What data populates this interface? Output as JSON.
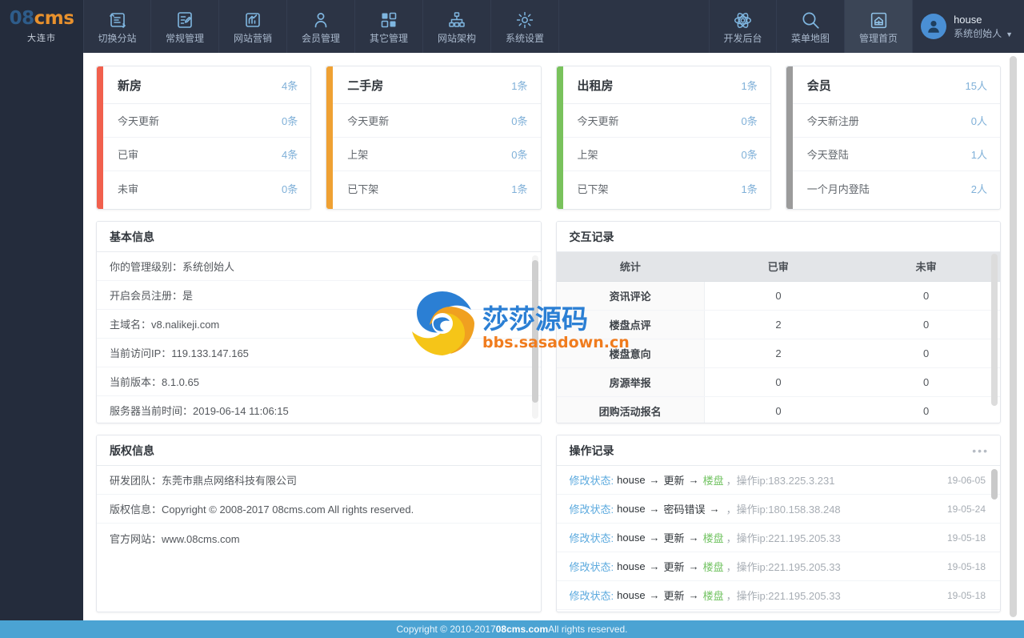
{
  "header": {
    "logo": {
      "part1": "08",
      "part2": "cms",
      "city": "大连市"
    },
    "nav_left": [
      {
        "label": "切换分站",
        "icon": "switch-site-icon"
      },
      {
        "label": "常规管理",
        "icon": "general-manage-icon"
      },
      {
        "label": "网站营销",
        "icon": "marketing-icon"
      },
      {
        "label": "会员管理",
        "icon": "member-icon"
      },
      {
        "label": "其它管理",
        "icon": "other-manage-icon"
      },
      {
        "label": "网站架构",
        "icon": "site-structure-icon"
      },
      {
        "label": "系统设置",
        "icon": "settings-icon"
      }
    ],
    "nav_right": [
      {
        "label": "开发后台",
        "icon": "dev-backend-icon",
        "active": false
      },
      {
        "label": "菜单地图",
        "icon": "search-icon",
        "active": false
      },
      {
        "label": "管理首页",
        "icon": "home-icon",
        "active": true
      }
    ],
    "user": {
      "name": "house",
      "role": "系统创始人",
      "caret": "▼"
    }
  },
  "stats": [
    {
      "title": "新房",
      "total": "4条",
      "color": "#f1604d",
      "rows": [
        {
          "label": "今天更新",
          "value": "0条"
        },
        {
          "label": "已审",
          "value": "4条"
        },
        {
          "label": "未审",
          "value": "0条"
        }
      ]
    },
    {
      "title": "二手房",
      "total": "1条",
      "color": "#efa133",
      "rows": [
        {
          "label": "今天更新",
          "value": "0条"
        },
        {
          "label": "上架",
          "value": "0条"
        },
        {
          "label": "已下架",
          "value": "1条"
        }
      ]
    },
    {
      "title": "出租房",
      "total": "1条",
      "color": "#79c25c",
      "rows": [
        {
          "label": "今天更新",
          "value": "0条"
        },
        {
          "label": "上架",
          "value": "0条"
        },
        {
          "label": "已下架",
          "value": "1条"
        }
      ]
    },
    {
      "title": "会员",
      "total": "15人",
      "color": "#9b9b9b",
      "rows": [
        {
          "label": "今天新注册",
          "value": "0人"
        },
        {
          "label": "今天登陆",
          "value": "1人"
        },
        {
          "label": "一个月内登陆",
          "value": "2人"
        }
      ]
    }
  ],
  "basic_info": {
    "title": "基本信息",
    "rows": [
      "你的管理级别：系统创始人",
      "开启会员注册：是",
      "主域名：v8.nalikeji.com",
      "当前访问IP：119.133.147.165",
      "当前版本：8.1.0.65",
      "服务器当前时间：2019-06-14 11:06:15"
    ]
  },
  "interaction": {
    "title": "交互记录",
    "columns": [
      "统计",
      "已审",
      "未审"
    ],
    "rows": [
      {
        "name": "资讯评论",
        "approved": "0",
        "pending": "0"
      },
      {
        "name": "楼盘点评",
        "approved": "2",
        "pending": "0"
      },
      {
        "name": "楼盘意向",
        "approved": "2",
        "pending": "0"
      },
      {
        "name": "房源举报",
        "approved": "0",
        "pending": "0"
      },
      {
        "name": "团购活动报名",
        "approved": "0",
        "pending": "0"
      }
    ]
  },
  "copyright_panel": {
    "title": "版权信息",
    "rows": [
      "研发团队：东莞市鼎点网络科技有限公司",
      "版权信息：Copyright © 2008-2017 08cms.com All rights reserved.",
      "官方网站：www.08cms.com"
    ]
  },
  "oplog": {
    "title": "操作记录",
    "more": "•••",
    "rows": [
      {
        "action": "修改状态:",
        "user": "house",
        "op": "更新",
        "object": "楼盘",
        "ip": "，操作ip:183.225.3.231",
        "date": "19-06-05"
      },
      {
        "action": "修改状态:",
        "user": "house",
        "op": "密码错误",
        "object": "",
        "ip": "，操作ip:180.158.38.248",
        "date": "19-05-24"
      },
      {
        "action": "修改状态:",
        "user": "house",
        "op": "更新",
        "object": "楼盘",
        "ip": "，操作ip:221.195.205.33",
        "date": "19-05-18"
      },
      {
        "action": "修改状态:",
        "user": "house",
        "op": "更新",
        "object": "楼盘",
        "ip": "，操作ip:221.195.205.33",
        "date": "19-05-18"
      },
      {
        "action": "修改状态:",
        "user": "house",
        "op": "更新",
        "object": "楼盘",
        "ip": "，操作ip:221.195.205.33",
        "date": "19-05-18"
      }
    ]
  },
  "watermark": {
    "text": "莎莎源码",
    "url": "bbs.sasadown.cn"
  },
  "footer": {
    "pre": "Copyright © 2010-2017 ",
    "brand": "08cms.com",
    "post": " All rights reserved."
  }
}
